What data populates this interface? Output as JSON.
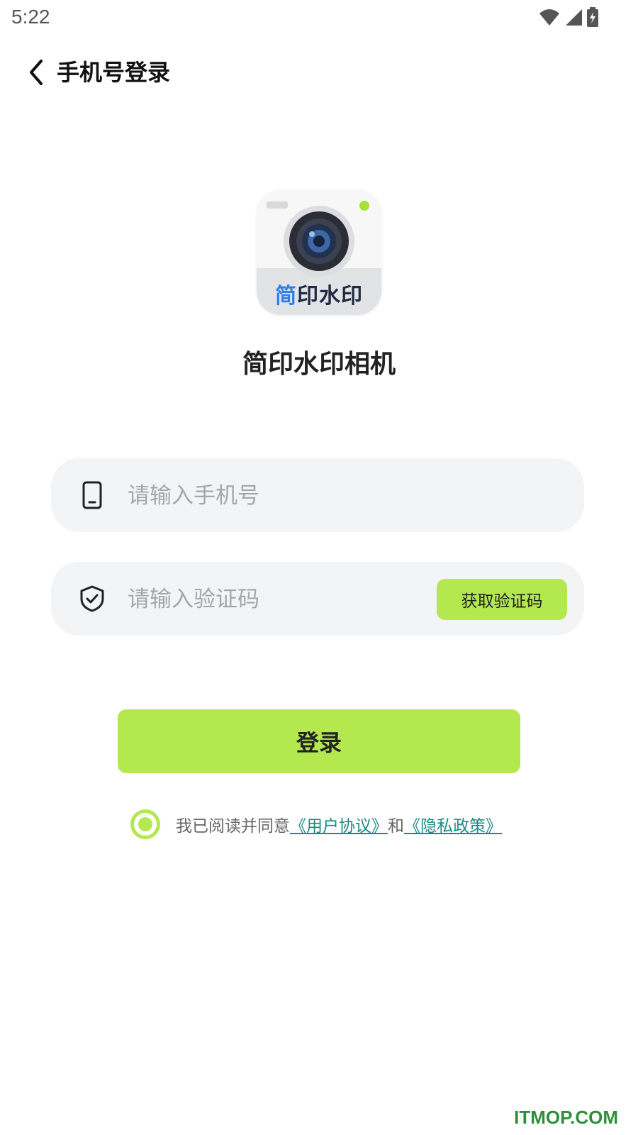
{
  "status_bar": {
    "time": "5:22",
    "icons": [
      "wifi-icon",
      "cell-signal-icon",
      "battery-charging-icon"
    ]
  },
  "nav": {
    "back_icon": "chevron-left-icon",
    "title": "手机号登录"
  },
  "app": {
    "logo_text": "简印水印",
    "name": "简印水印相机"
  },
  "phone_field": {
    "icon": "phone-icon",
    "placeholder": "请输入手机号",
    "value": ""
  },
  "code_field": {
    "icon": "shield-check-icon",
    "placeholder": "请输入验证码",
    "value": "",
    "get_code_label": "获取验证码"
  },
  "login_button": {
    "label": "登录"
  },
  "agreement": {
    "checked": true,
    "prefix": "我已阅读并同意",
    "user_agreement": "《用户协议》",
    "conjunction": "和",
    "privacy_policy": "《隐私政策》"
  },
  "watermark": "ITMOP.COM",
  "colors": {
    "accent": "#b3e84f",
    "link": "#1b8a86",
    "field_bg": "#f3f4f6",
    "logo_blue": "#2f7ff0",
    "watermark": "#2d8f3a"
  }
}
